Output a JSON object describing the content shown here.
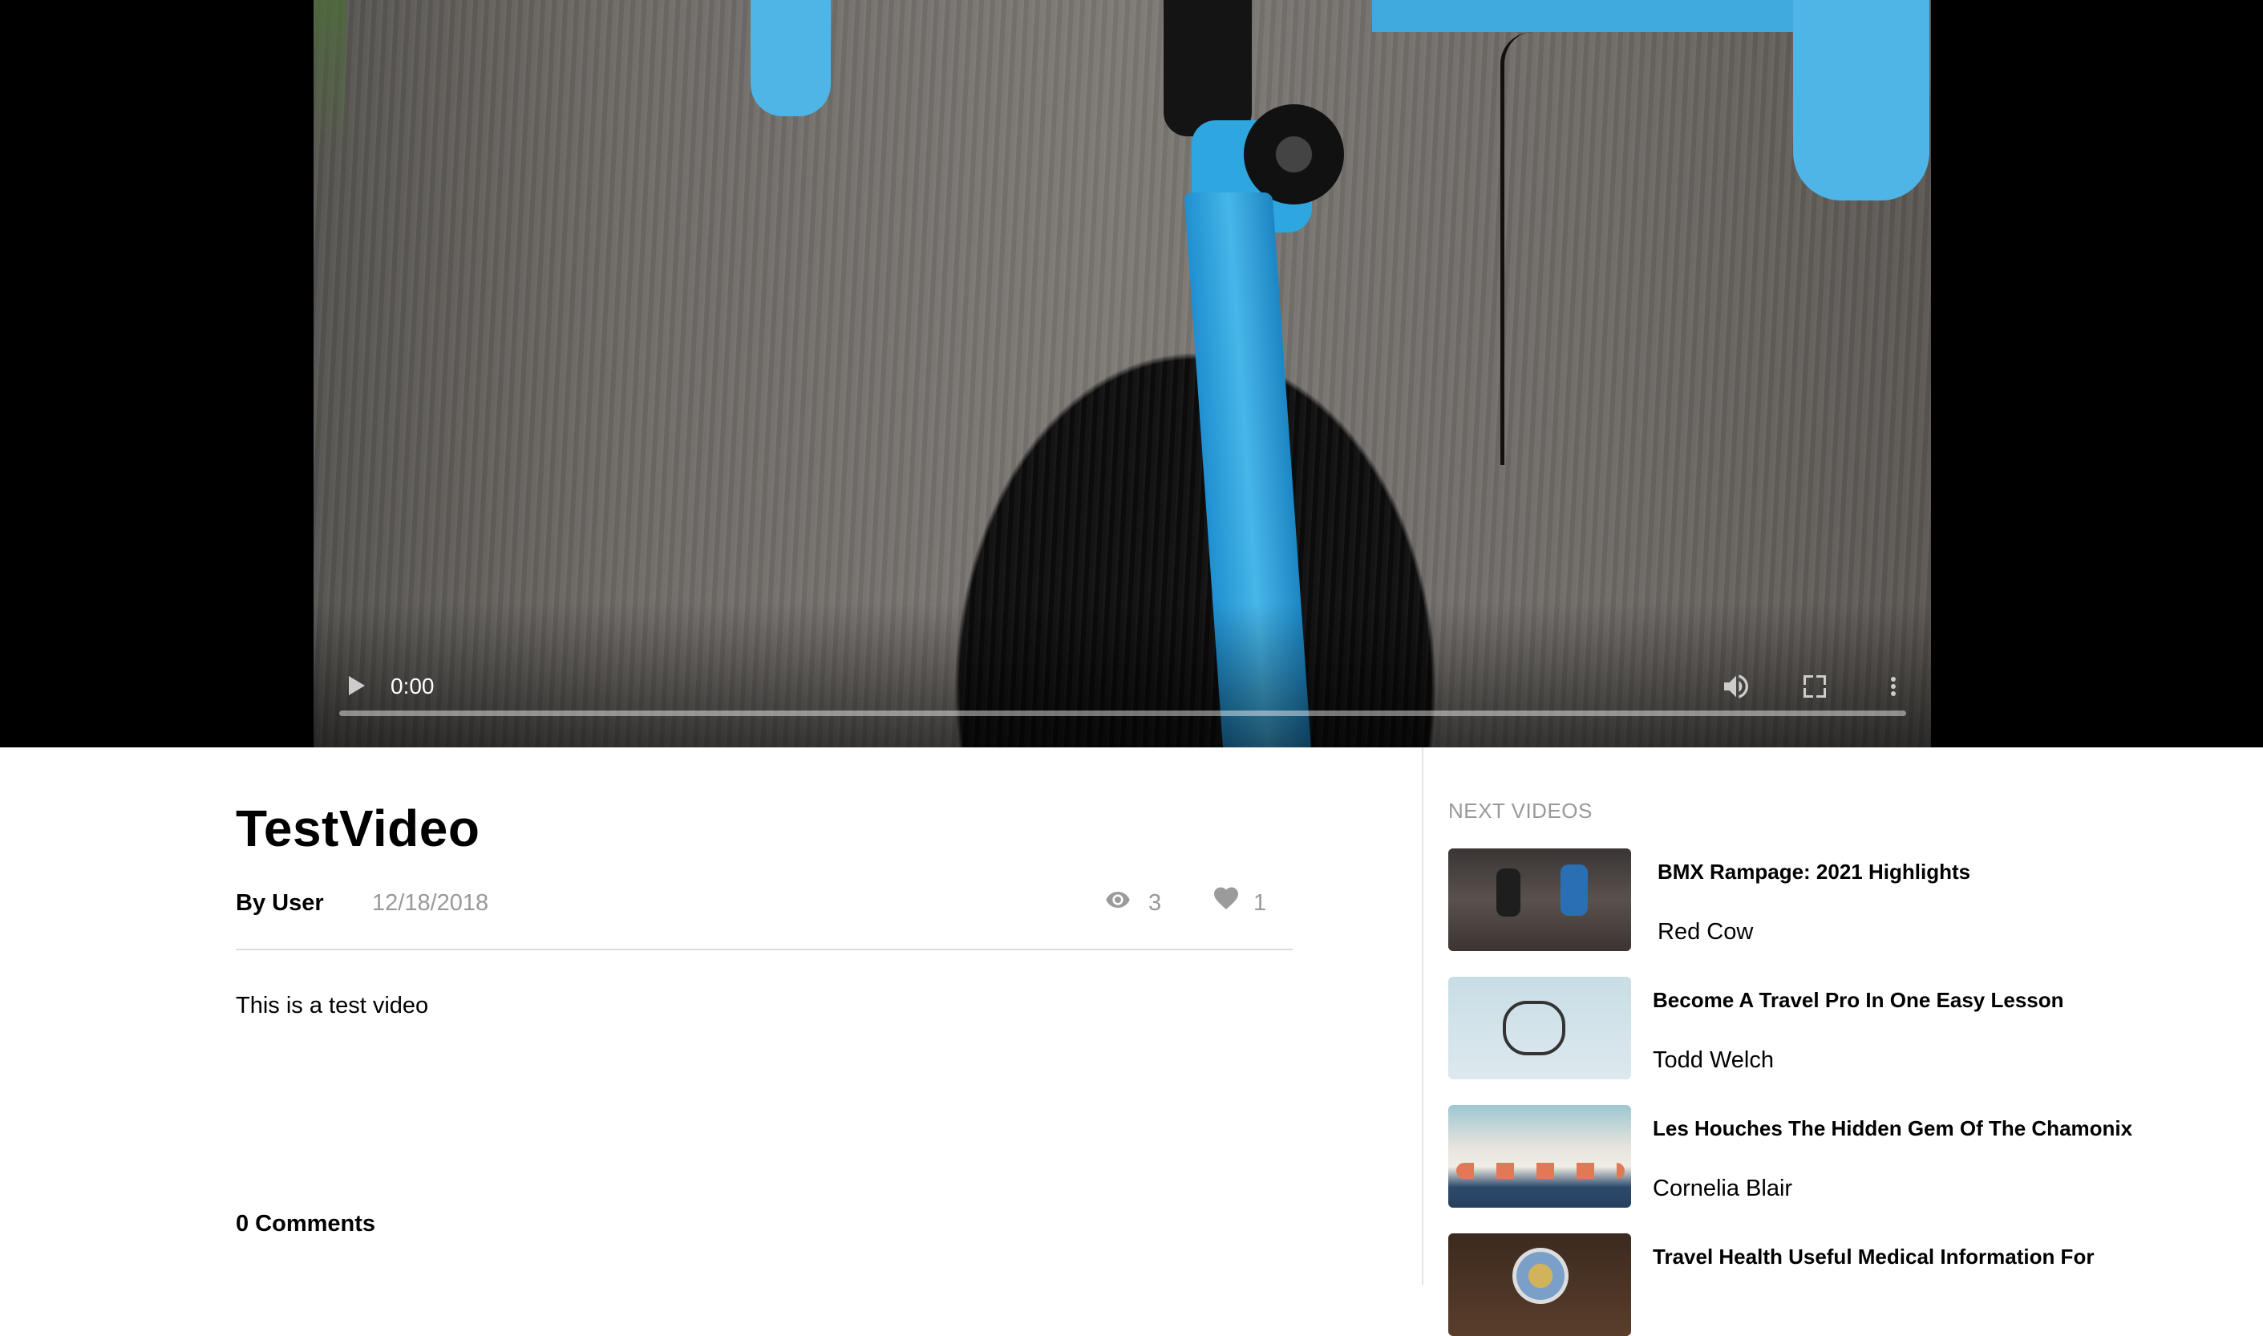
{
  "player": {
    "current_time": "0:00",
    "progress": 0
  },
  "video": {
    "title": "TestVideo",
    "byline": "By User",
    "date": "12/18/2018",
    "views": "3",
    "likes": "1",
    "description": "This is a test video",
    "comments_label": "0 Comments"
  },
  "sidebar": {
    "heading": "NEXT VIDEOS",
    "items": [
      {
        "title": "BMX Rampage: 2021 Highlights",
        "author": "Red Cow"
      },
      {
        "title": "Become A Travel Pro In One Easy Lesson",
        "author": "Todd Welch"
      },
      {
        "title": "Les Houches The Hidden Gem Of The Chamonix",
        "author": "Cornelia Blair"
      },
      {
        "title": "Travel Health Useful Medical Information For",
        "author": ""
      }
    ]
  },
  "colors": {
    "muted_text": "#999999",
    "divider": "#dcdcdc",
    "player_bg": "#000000"
  },
  "icons": {
    "views": "eye-icon",
    "likes": "heart-icon",
    "play": "play-icon",
    "volume": "volume-icon",
    "fullscreen": "fullscreen-icon",
    "more": "more-vertical-icon"
  }
}
